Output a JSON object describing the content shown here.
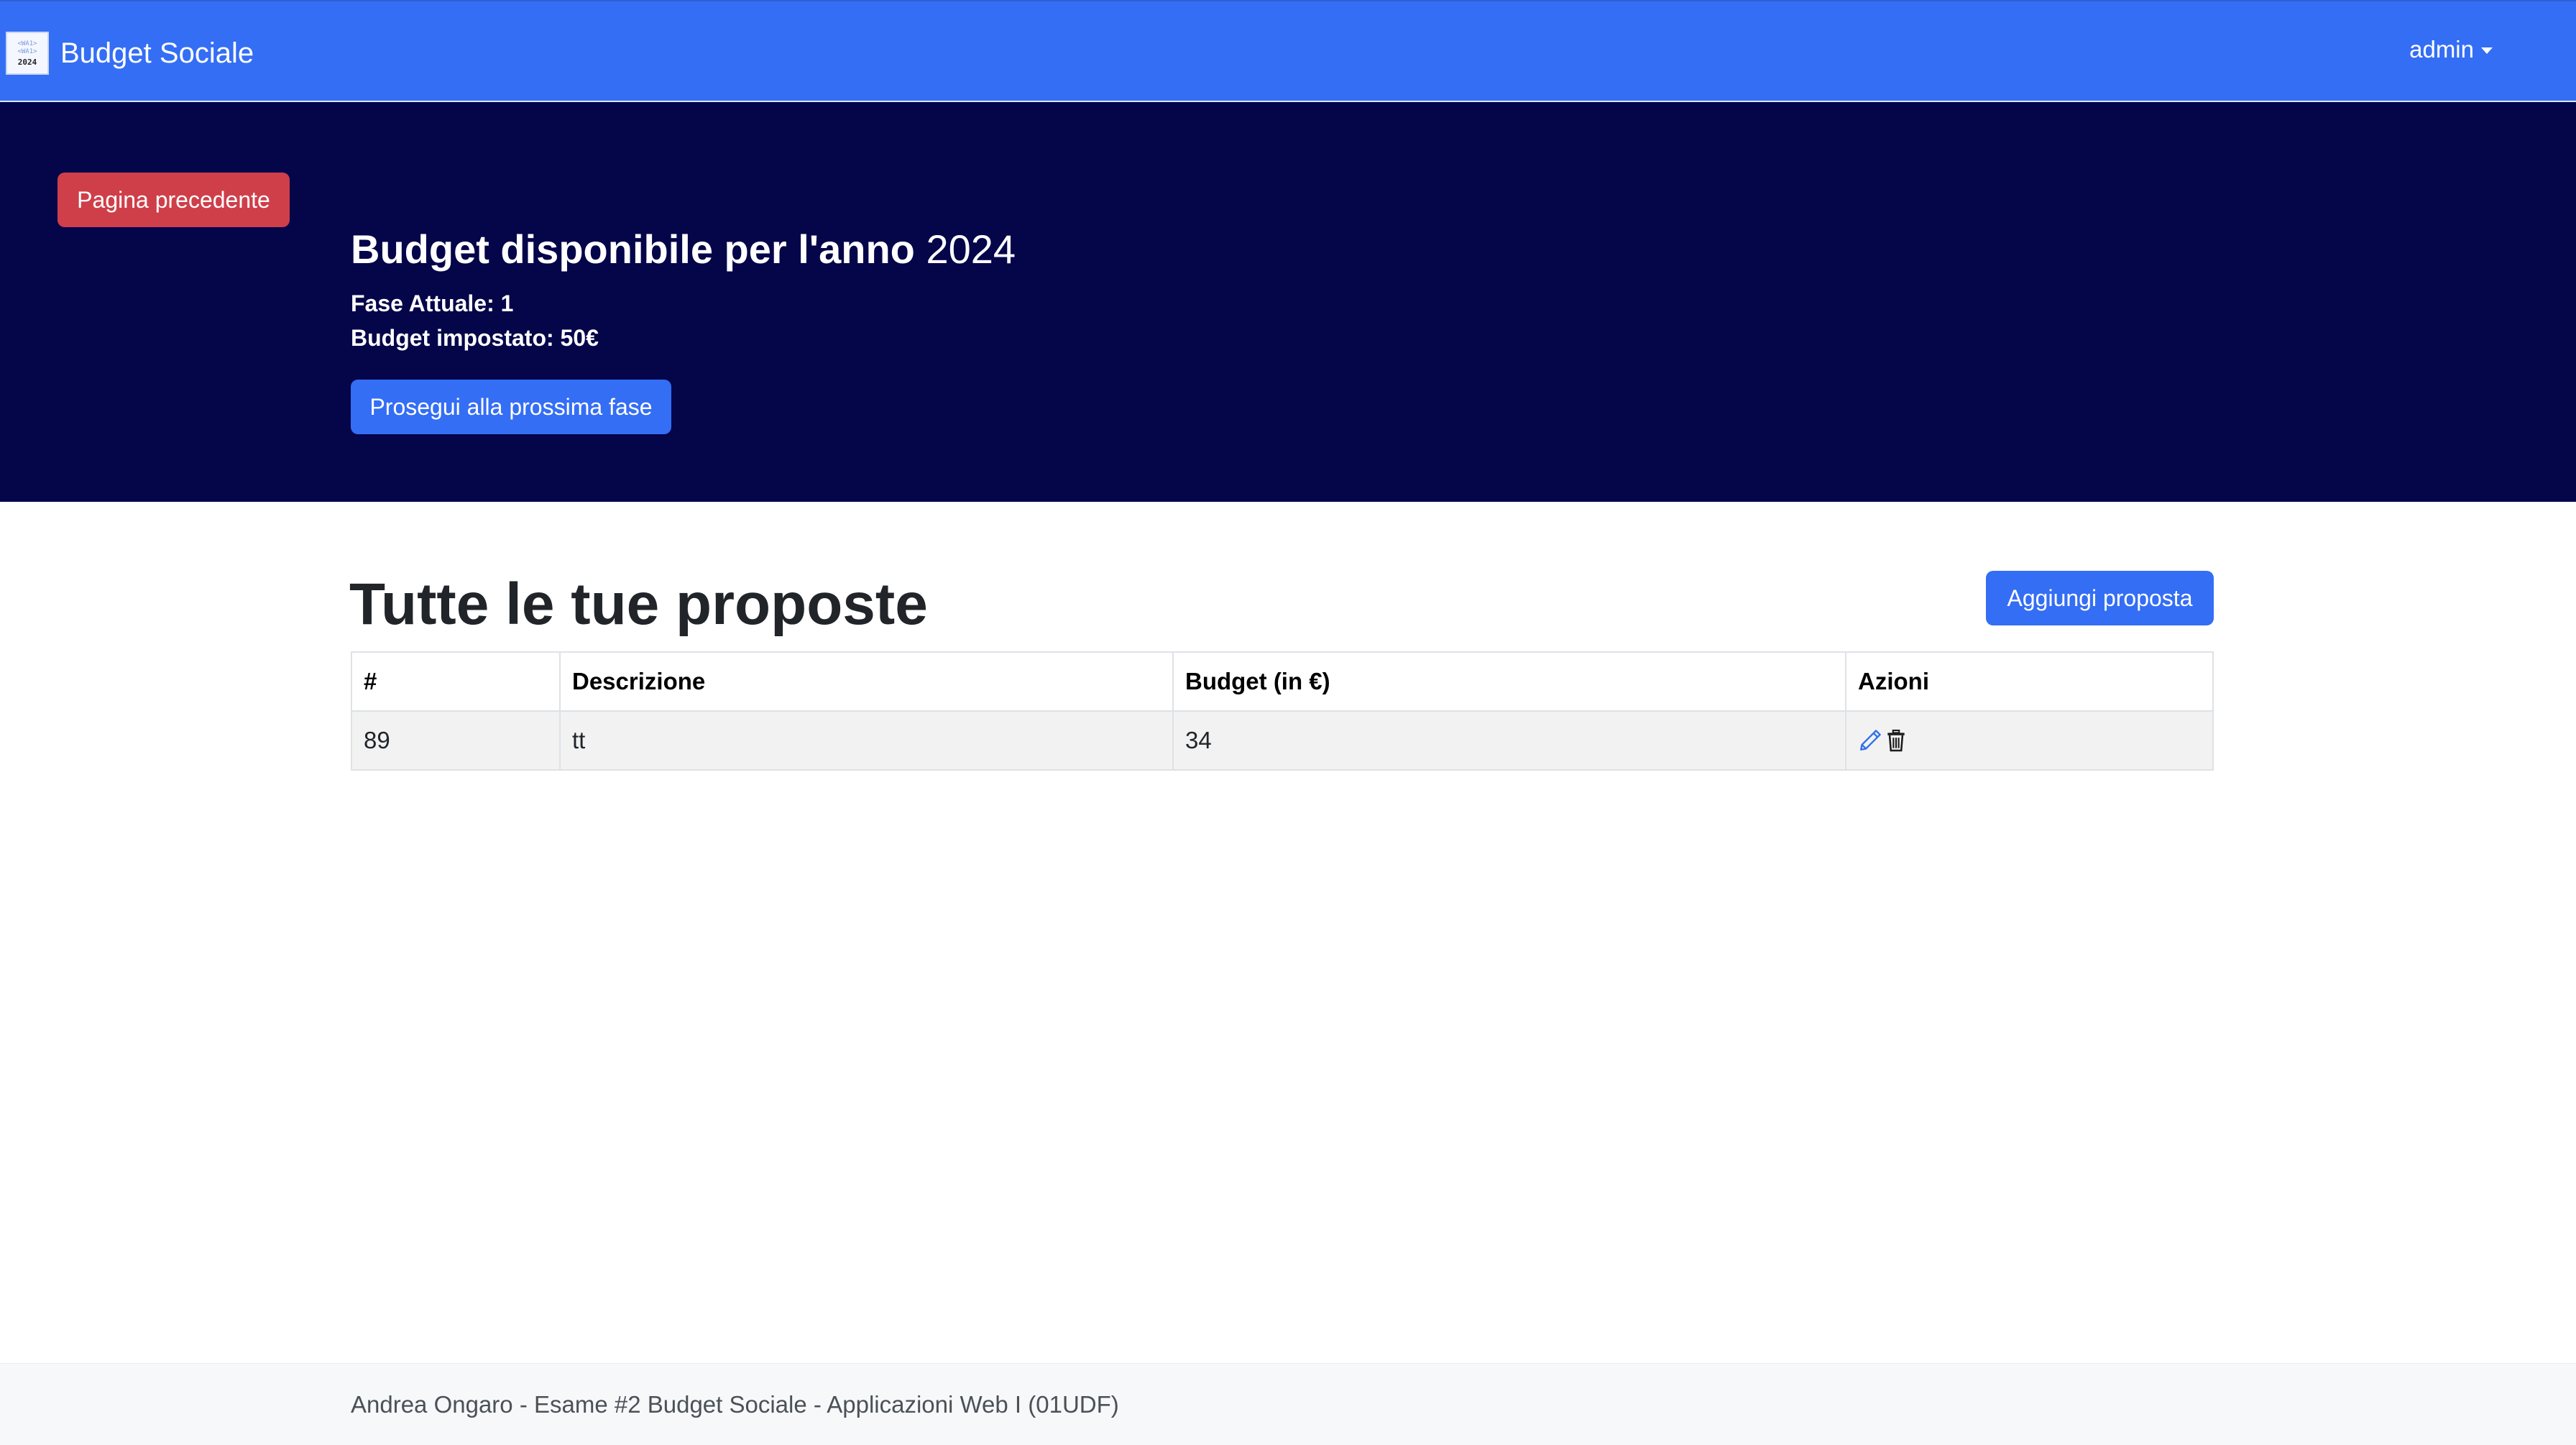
{
  "navbar": {
    "logo_lines": [
      "<WA1>",
      "<WA1>",
      "2024"
    ],
    "brand": "Budget Sociale",
    "user": "admin"
  },
  "hero": {
    "back_button": "Pagina precedente",
    "title": "Budget disponibile per l'anno",
    "year": "2024",
    "phase": "Fase Attuale: 1",
    "budget": "Budget impostato: 50€",
    "next_button": "Prosegui alla prossima fase"
  },
  "main": {
    "title": "Tutte le tue proposte",
    "add_button": "Aggiungi proposta",
    "table": {
      "headers": [
        "#",
        "Descrizione",
        "Budget (in €)",
        "Azioni"
      ],
      "rows": [
        {
          "id": "89",
          "description": "tt",
          "budget": "34",
          "actions": [
            "pencil-icon",
            "trash-icon"
          ]
        }
      ]
    }
  },
  "footer": {
    "text": "Andrea Ongaro - Esame #2 Budget Sociale - Applicazioni Web I (01UDF)"
  },
  "colors": {
    "navbar": "#346ef5",
    "hero_bg": "#05054a",
    "primary_button": "#346ef5",
    "danger_button": "#cf3f49"
  }
}
